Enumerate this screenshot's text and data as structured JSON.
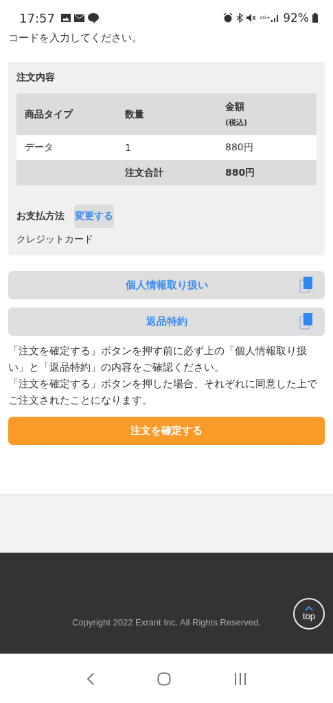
{
  "status_bar": {
    "time": "17:57",
    "battery": "92%",
    "network": "4G+"
  },
  "intro_text": "コードを入力してください。",
  "order": {
    "title": "注文内容",
    "columns": [
      {
        "label": "商品タイプ"
      },
      {
        "label": "数量"
      },
      {
        "label": "金額",
        "sub": "(税込)"
      }
    ],
    "rows": [
      [
        "データ",
        "1",
        "880円"
      ]
    ],
    "total": {
      "label": "注文合計",
      "value": "880円"
    },
    "payment": {
      "label": "お支払方法",
      "change": "変更する",
      "method": "クレジットカード"
    }
  },
  "links": [
    {
      "label": "個人情報取り扱い"
    },
    {
      "label": "返品特約"
    }
  ],
  "notice": [
    "「注文を確定する」ボタンを押す前に必ず上の「個人情報取り扱い」と「返品特約」の内容をご確認ください。",
    "「注文を確定する」ボタンを押した場合、それぞれに同意した上でご注文されたことになります。"
  ],
  "confirm_button": "注文を確定する",
  "footer": {
    "copyright": "Copyright 2022 Exrant Inc. All Rights Reserved.",
    "top_button": "top"
  }
}
